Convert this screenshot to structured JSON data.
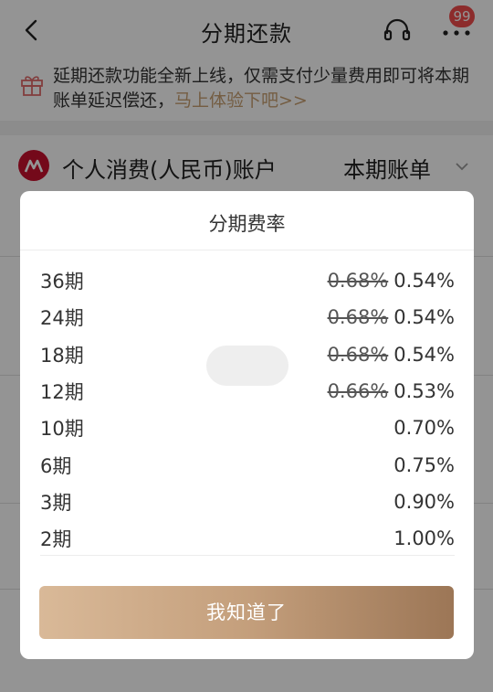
{
  "nav": {
    "title": "分期还款",
    "badge": "99",
    "back_icon": "chevron-left-icon",
    "headset_icon": "headset-icon",
    "more_icon": "more-dots-icon"
  },
  "notice": {
    "icon": "gift-icon",
    "text": "延期还款功能全新上线，仅需支付少量费用即可将本期账单延迟偿还，",
    "link": "马上体验下吧>>"
  },
  "account": {
    "logo": "bank-logo-icon",
    "name": "个人消费(人民币)账户",
    "bill_label": "本期账单",
    "chevron": "chevron-down-icon"
  },
  "modal": {
    "title": "分期费率",
    "rates": [
      {
        "term": "36期",
        "old_rate": "0.68%",
        "rate": "0.54%"
      },
      {
        "term": "24期",
        "old_rate": "0.68%",
        "rate": "0.54%"
      },
      {
        "term": "18期",
        "old_rate": "0.68%",
        "rate": "0.54%"
      },
      {
        "term": "12期",
        "old_rate": "0.66%",
        "rate": "0.53%"
      },
      {
        "term": "10期",
        "old_rate": "",
        "rate": "0.70%"
      },
      {
        "term": "6期",
        "old_rate": "",
        "rate": "0.75%"
      },
      {
        "term": "3期",
        "old_rate": "",
        "rate": "0.90%"
      },
      {
        "term": "2期",
        "old_rate": "",
        "rate": "1.00%"
      }
    ],
    "confirm_label": "我知道了"
  },
  "colors": {
    "accent_gold": "#c9a073",
    "badge_red": "#f24c4c",
    "bank_red": "#c8102e"
  }
}
